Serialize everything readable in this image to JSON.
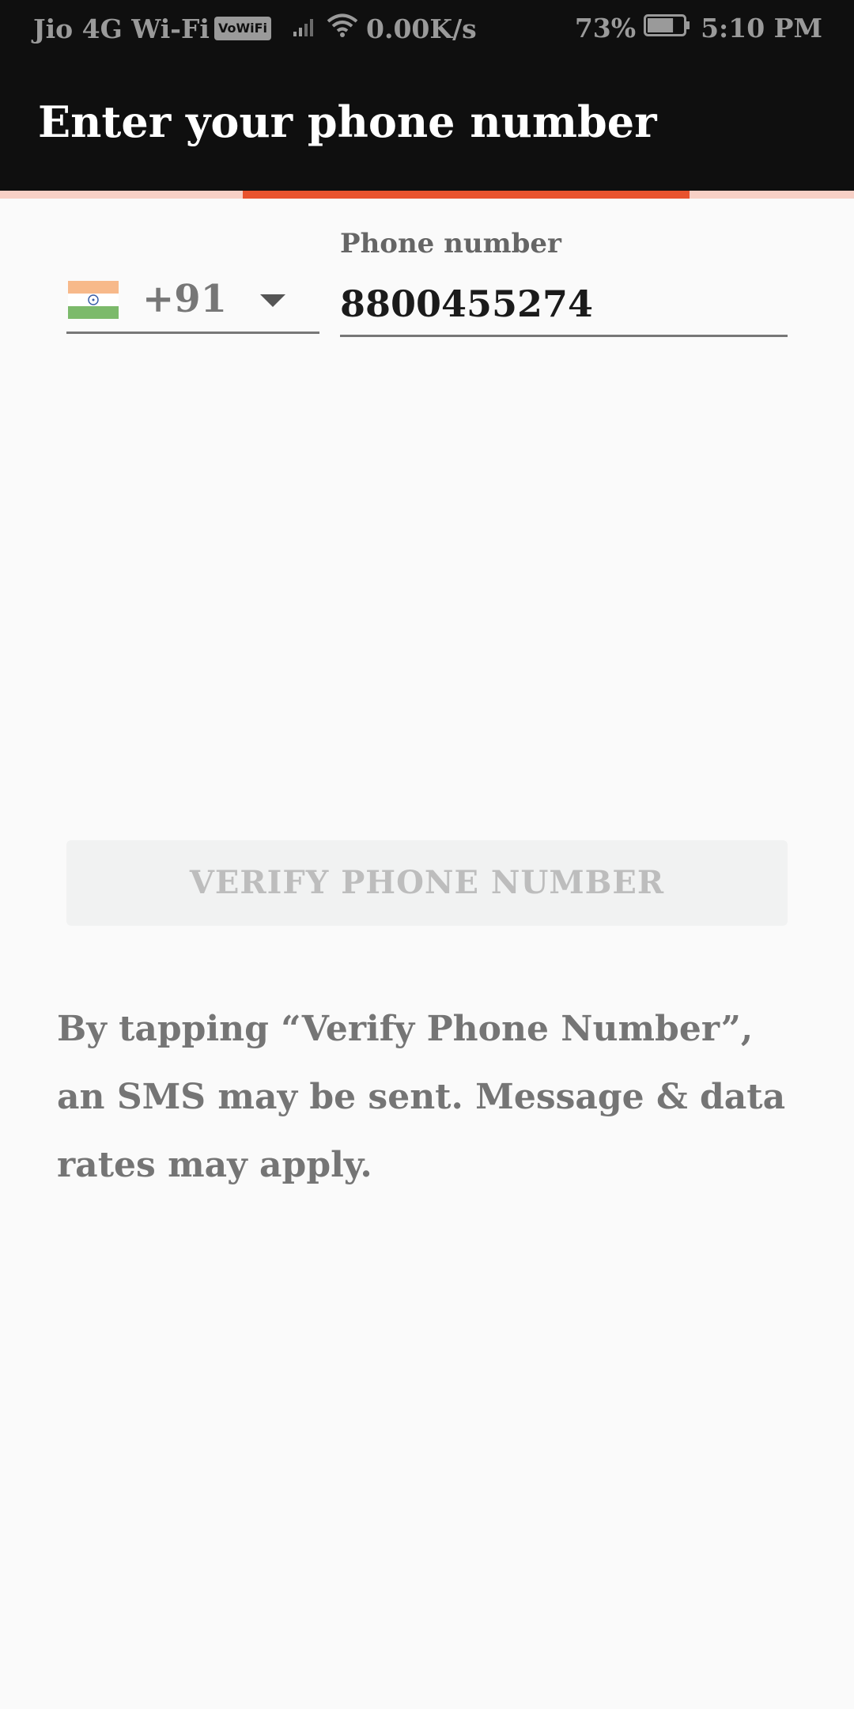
{
  "status_bar": {
    "carrier": "Jio 4G Wi-Fi",
    "vowifi_badge": "VoWiFi",
    "net_speed": "0.00K/s",
    "battery_percent": "73%",
    "time": "5:10 PM",
    "battery_level": 0.73
  },
  "app_bar": {
    "title": "Enter your phone number"
  },
  "progress": {
    "fill_fraction": 0.52,
    "colors": {
      "track": "#f7d0c6",
      "fill": "#e8532e"
    }
  },
  "form": {
    "country_flag": "india-flag-icon",
    "country_code": "+91",
    "phone_label": "Phone number",
    "phone_value": "8800455274"
  },
  "verify_button": {
    "label": "VERIFY PHONE NUMBER"
  },
  "disclaimer": "By tapping “Verify Phone Number”, an SMS may be sent. Message & data rates may apply.",
  "colors": {
    "app_bar_bg": "#0f0f0f",
    "page_bg": "#fafafa",
    "button_bg": "#f1f2f2",
    "button_text": "#bdbdbd"
  }
}
